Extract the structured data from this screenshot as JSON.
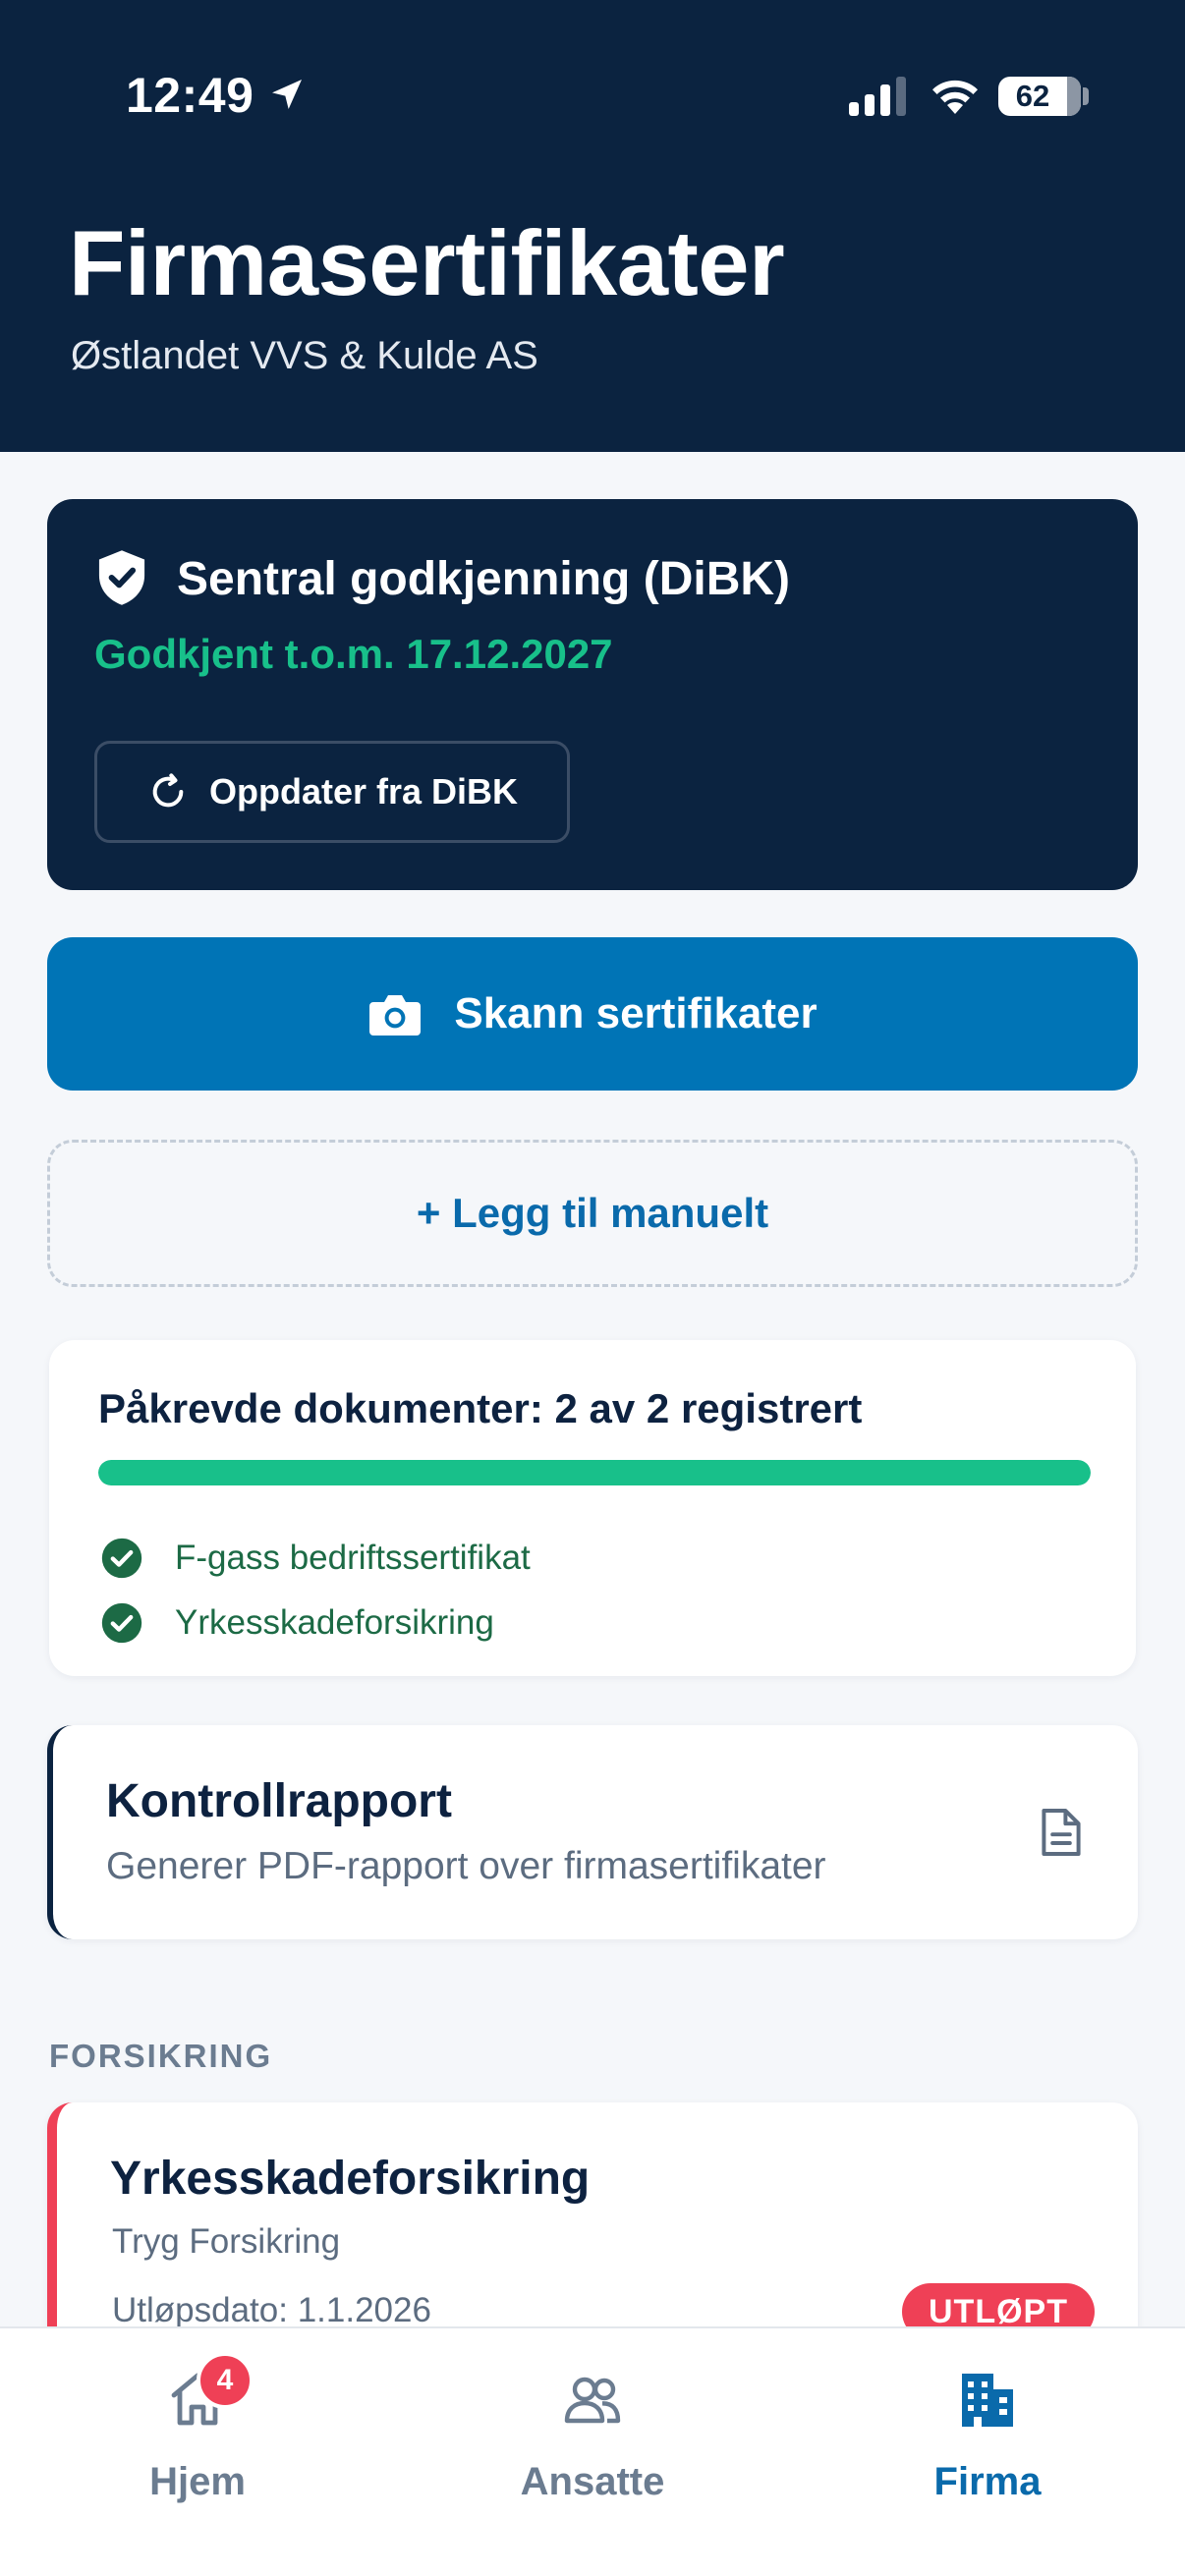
{
  "status_bar": {
    "time": "12:49",
    "battery": "62",
    "icons": [
      "location-arrow-icon",
      "signal-icon",
      "wifi-icon",
      "battery-icon"
    ]
  },
  "header": {
    "title": "Firmasertifikater",
    "subtitle": "Østlandet VVS & Kulde AS"
  },
  "dibk": {
    "title": "Sentral godkjenning (DiBK)",
    "status": "Godkjent t.o.m. 17.12.2027",
    "refresh_label": "Oppdater fra DiBK",
    "status_color": "#18c08a"
  },
  "actions": {
    "scan_label": "Skann sertifikater",
    "manual_label": "+ Legg til manuelt"
  },
  "required_docs": {
    "title": "Påkrevde dokumenter: 2 av 2 registrert",
    "progress": 1.0,
    "items": [
      {
        "label": "F-gass bedriftssertifikat",
        "done": true
      },
      {
        "label": "Yrkesskadeforsikring",
        "done": true
      }
    ]
  },
  "report": {
    "title": "Kontrollrapport",
    "subtitle": "Generer PDF-rapport over firmasertifikater"
  },
  "section": {
    "label": "FORSIKRING"
  },
  "insurance": {
    "title": "Yrkesskadeforsikring",
    "provider": "Tryg Forsikring",
    "expiry": "Utløpsdato: 1.1.2026",
    "badge": "UTLØPT",
    "accent_color": "#ef4056"
  },
  "tabs": [
    {
      "label": "Hjem",
      "icon": "home-icon",
      "badge": "4",
      "active": false
    },
    {
      "label": "Ansatte",
      "icon": "people-icon",
      "active": false
    },
    {
      "label": "Firma",
      "icon": "building-icon",
      "active": true
    }
  ],
  "colors": {
    "navy": "#0b2340",
    "primary": "#0074b6",
    "success": "#18c08a",
    "danger": "#ef4056"
  }
}
